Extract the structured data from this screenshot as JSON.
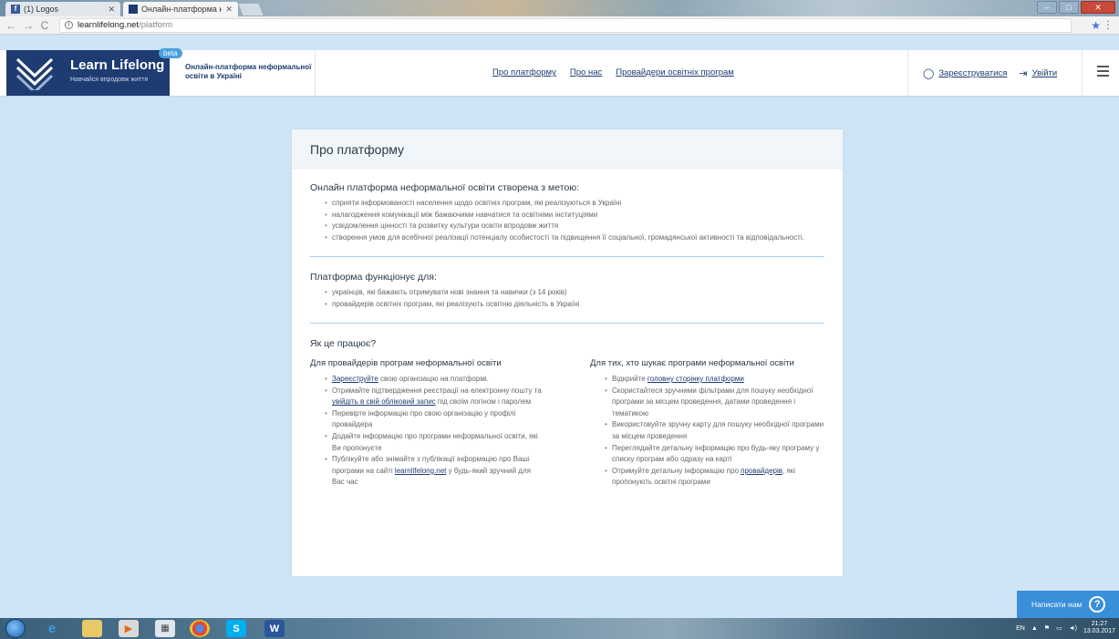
{
  "browser": {
    "tabs": [
      {
        "title": "(1) Logos",
        "active": false
      },
      {
        "title": "Онлайн-платформа нео",
        "active": true
      }
    ],
    "url_host": "learnlifelong.net",
    "url_path": "/platform"
  },
  "header": {
    "logo_title": "Learn Lifelong",
    "logo_subtitle": "Навчайся впродовж життя",
    "beta": "beta",
    "tagline": "Онлайн-платформа неформальної освіти в Україні",
    "nav": [
      "Про платформу",
      "Про нас",
      "Провайдери освітніх програм"
    ],
    "register": "Зареєструватися",
    "login": "Увійти"
  },
  "card": {
    "title": "Про платформу",
    "section1": {
      "title": "Онлайн платформа неформальної освіти створена з метою:",
      "items": [
        "сприяти інформованості населення щодо освітніх програм, які реалізуються в Україні",
        "налагодження комунікації між бажаючими навчатися та освітніми інституціями",
        "усвідомлення цінності та розвитку культури освіти впродовж життя",
        "створення умов для всебічної реалізації потенціалу особистості та підвищення її соціальної, громадянської активності та відповідальності."
      ]
    },
    "section2": {
      "title": "Платформа функціонує для:",
      "items": [
        "українців, які бажають отримувати нові знання та навички (з 14 років)",
        "провайдерів освітніх програм, які реалізують освітню діяльність в Україні"
      ]
    },
    "section3": {
      "title": "Як це працює?",
      "left": {
        "title": "Для провайдерів програм неформальної освіти",
        "i1_link": "Зареєструйте",
        "i1_rest": " свою організацію на платформі.",
        "i2_pre": "Отримайте підтвердження реєстрації на електронну пошту та ",
        "i2_link": "увійдіть в свій обліковий запис",
        "i2_post": " під своїм логіном і паролем",
        "i3": "Перевірте інформацію про свою організацію у профілі провайдера",
        "i4": "Додайте інформацію про програми неформальної освіти, які Ви пропонуєте",
        "i5_pre": "Публікуйте або знімайте з публікації інформацію про Ваші програми на сайті ",
        "i5_link": "learnlifelong.net",
        "i5_post": " у будь-який зручний для Вас час"
      },
      "right": {
        "title": "Для тих, хто шукає програми неформальної освіти",
        "i1_pre": "Відкрийте ",
        "i1_link": "головну сторінку платформи",
        "i2": "Скористайтеся зручними фільтрами для пошуку необхідної програми за місцем проведення, датами проведення і тематикою",
        "i3": "Використовуйте зручну карту для пошуку необхідної програми за місцем проведення",
        "i4": "Переглядайте детальну інформацію про будь-яку програму у списку програм або одразу на карті",
        "i5_pre": "Отримуйте детальну інформацію про ",
        "i5_link": "провайдерів",
        "i5_post": ", які пропонують освітні програми"
      }
    }
  },
  "chat": {
    "label": "Написати нам",
    "icon": "question-icon"
  },
  "taskbar": {
    "lang": "EN",
    "time": "21:27",
    "date": "13.03.2017"
  },
  "colors": {
    "brand": "#1e3c72",
    "accent": "#3a8fd9",
    "background": "#cfe4f5"
  }
}
